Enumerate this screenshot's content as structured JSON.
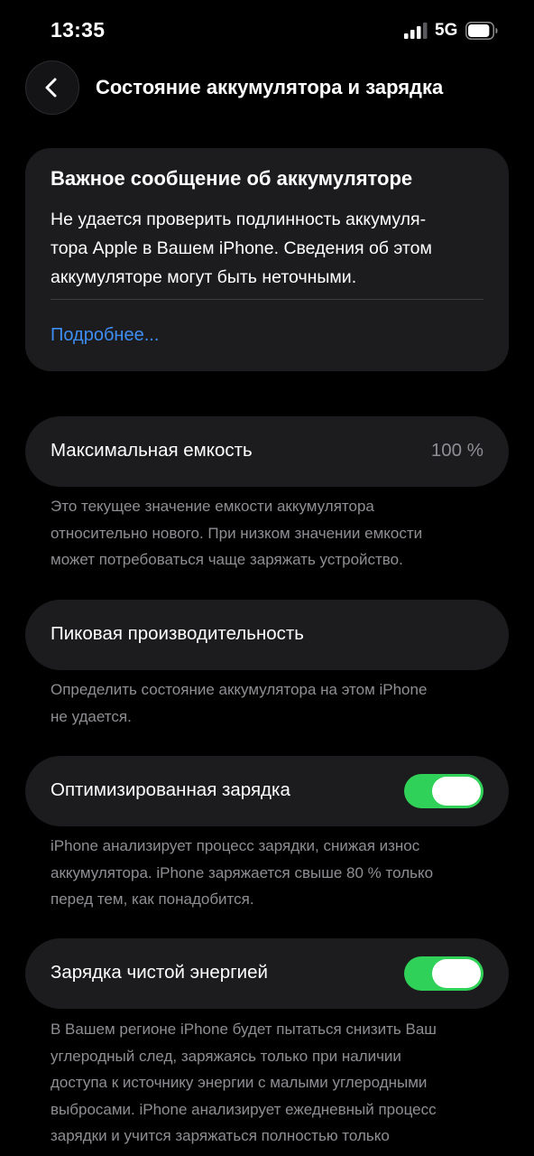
{
  "status_bar": {
    "time": "13:35",
    "network": "5G",
    "signal_icon": "cellular-signal-icon",
    "battery_icon": "battery-icon",
    "battery_level": 0.9
  },
  "nav": {
    "back_icon": "chevron-left-icon",
    "title": "Состояние аккумулятора и зарядка"
  },
  "battery_message": {
    "title": "Важное сообщение об аккумуляторе",
    "body_lines": [
      "Не удается проверить подлинность аккумуля-",
      "тора Apple в Вашем iPhone. Сведения об этом",
      "аккумуляторе могут быть неточными."
    ],
    "link": "Подробнее..."
  },
  "max_capacity": {
    "label": "Максимальная емкость",
    "value": "100 %",
    "footnote_lines": [
      "Это текущее значение емкости аккумулятора",
      "относительно нового. При низком значении емкости",
      "может потребоваться чаще заряжать устройство."
    ]
  },
  "peak_performance": {
    "label": "Пиковая производительность",
    "footnote_lines": [
      "Определить состояние аккумулятора на этом iPhone",
      "не удается."
    ]
  },
  "optimized_charging": {
    "label": "Оптимизированная зарядка",
    "enabled": true,
    "footnote_lines": [
      "iPhone анализирует процесс зарядки, снижая износ",
      "аккумулятора. iPhone заряжается свыше 80 % только",
      "перед тем, как понадобится."
    ]
  },
  "clean_energy_charging": {
    "label": "Зарядка чистой энергией",
    "enabled": true,
    "footnote_lines": [
      "В Вашем регионе iPhone будет пытаться снизить Ваш",
      "углеродный след, заряжаясь только при наличии",
      "доступа к источнику энергии с малыми углеродными",
      "выбросами. iPhone анализирует ежедневный процесс",
      "зарядки и учится заряжаться полностью только"
    ]
  },
  "colors": {
    "background": "#000000",
    "card": "#1c1c1e",
    "link": "#3e8df3",
    "toggle_on": "#30d158",
    "secondary_text": "#8e8e93"
  }
}
